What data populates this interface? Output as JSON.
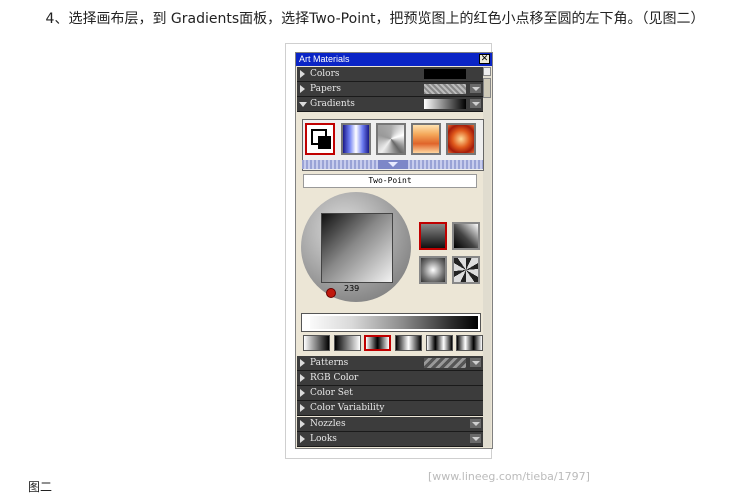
{
  "instruction": "4、选择画布层，到 Gradients面板，选择Two-Point，把预览图上的红色小点移至圆的左下角。（见图二）",
  "panel": {
    "title": "Art Materials",
    "close_glyph": "✕",
    "sections_top": [
      {
        "label": "Colors",
        "expanded": false
      },
      {
        "label": "Papers",
        "expanded": false
      },
      {
        "label": "Gradients",
        "expanded": true
      }
    ],
    "gradient_name": "Two-Point",
    "angle_value": "239",
    "sections_bottom": [
      {
        "label": "Patterns"
      },
      {
        "label": "RGB Color"
      },
      {
        "label": "Color Set"
      },
      {
        "label": "Color Variability"
      },
      {
        "label": "Nozzles"
      },
      {
        "label": "Looks"
      }
    ]
  },
  "caption": "图二",
  "watermark": "[www.lineeg.com/tieba/1797]",
  "colors": {
    "accent_red": "#c00000",
    "titlebar_blue": "#0a24c6",
    "section_dark": "#3c3c3c"
  }
}
